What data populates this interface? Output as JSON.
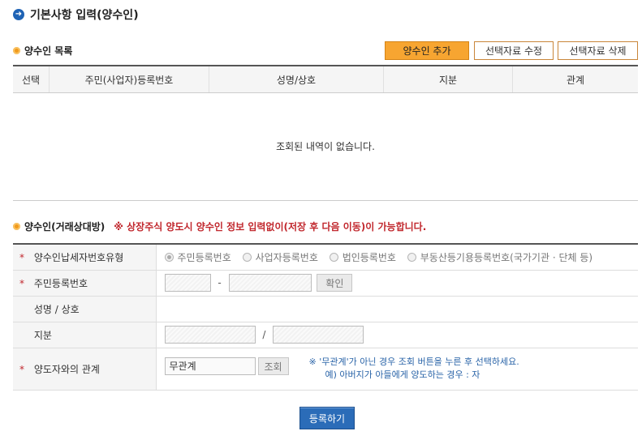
{
  "page": {
    "title": "기본사항 입력(양수인)"
  },
  "list_section": {
    "title": "양수인 목록",
    "buttons": {
      "add": "양수인 추가",
      "edit": "선택자료 수정",
      "delete": "선택자료 삭제"
    },
    "columns": [
      "선택",
      "주민(사업자)등록번호",
      "성명/상호",
      "지분",
      "관계"
    ],
    "empty_message": "조회된 내역이 없습니다."
  },
  "form_section": {
    "title": "양수인(거래상대방)",
    "warning": "※ 상장주식 양도시 양수인 정보 입력없이(저장 후 다음 이동)이 가능합니다.",
    "rows": {
      "type": {
        "required": "*",
        "label": "양수인납세자번호유형",
        "options": [
          "주민등록번호",
          "사업자등록번호",
          "법인등록번호",
          "부동산등기용등록번호(국가기관 · 단체 등)"
        ]
      },
      "id": {
        "required": "*",
        "label": "주민등록번호",
        "separator": "-",
        "confirm_button": "확인"
      },
      "name": {
        "label": "성명 / 상호"
      },
      "share": {
        "label": "지분",
        "separator": "/"
      },
      "relation": {
        "required": "*",
        "label": "양도자와의 관계",
        "value": "무관계",
        "lookup_button": "조회",
        "note_line1": "※ '무관계'가 아닌 경우 조회 버튼을 누른 후 선택하세요.",
        "note_line2": "예) 아버지가 아들에게 양도하는 경우 : 자"
      }
    }
  },
  "submit_label": "등록하기"
}
